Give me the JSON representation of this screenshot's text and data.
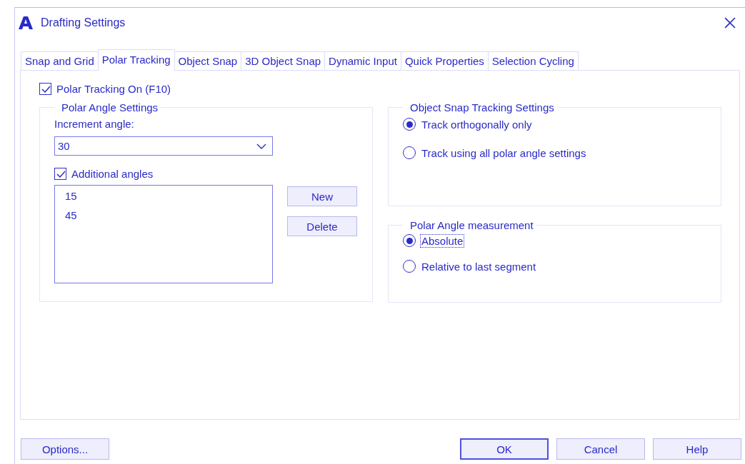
{
  "window": {
    "title": "Drafting Settings"
  },
  "tabs": [
    {
      "label": "Snap and Grid",
      "selected": false
    },
    {
      "label": "Polar Tracking",
      "selected": true
    },
    {
      "label": "Object Snap",
      "selected": false
    },
    {
      "label": "3D Object Snap",
      "selected": false
    },
    {
      "label": "Dynamic Input",
      "selected": false
    },
    {
      "label": "Quick Properties",
      "selected": false
    },
    {
      "label": "Selection Cycling",
      "selected": false
    }
  ],
  "polar_tracking_on": {
    "label": "Polar Tracking On (F10)",
    "checked": true
  },
  "polar_angle_settings": {
    "title": "Polar Angle Settings",
    "increment_label": "Increment angle:",
    "increment_value": "30",
    "additional": {
      "label": "Additional angles",
      "checked": true
    },
    "angles": [
      "15",
      "45"
    ],
    "buttons": [
      "New",
      "Delete"
    ]
  },
  "object_snap_tracking": {
    "title": "Object Snap Tracking Settings",
    "options": [
      {
        "label": "Track orthogonally only",
        "selected": true,
        "focused": false
      },
      {
        "label": "Track using all polar angle settings",
        "selected": false,
        "focused": false
      }
    ]
  },
  "polar_angle_measurement": {
    "title": "Polar Angle measurement",
    "options": [
      {
        "label": "Absolute",
        "selected": true,
        "focused": true
      },
      {
        "label": "Relative to last segment",
        "selected": false,
        "focused": false
      }
    ]
  },
  "footer": {
    "options_button": "Options...",
    "buttons": [
      {
        "label": "OK",
        "default": true
      },
      {
        "label": "Cancel",
        "default": false
      },
      {
        "label": "Help",
        "default": false
      }
    ]
  }
}
